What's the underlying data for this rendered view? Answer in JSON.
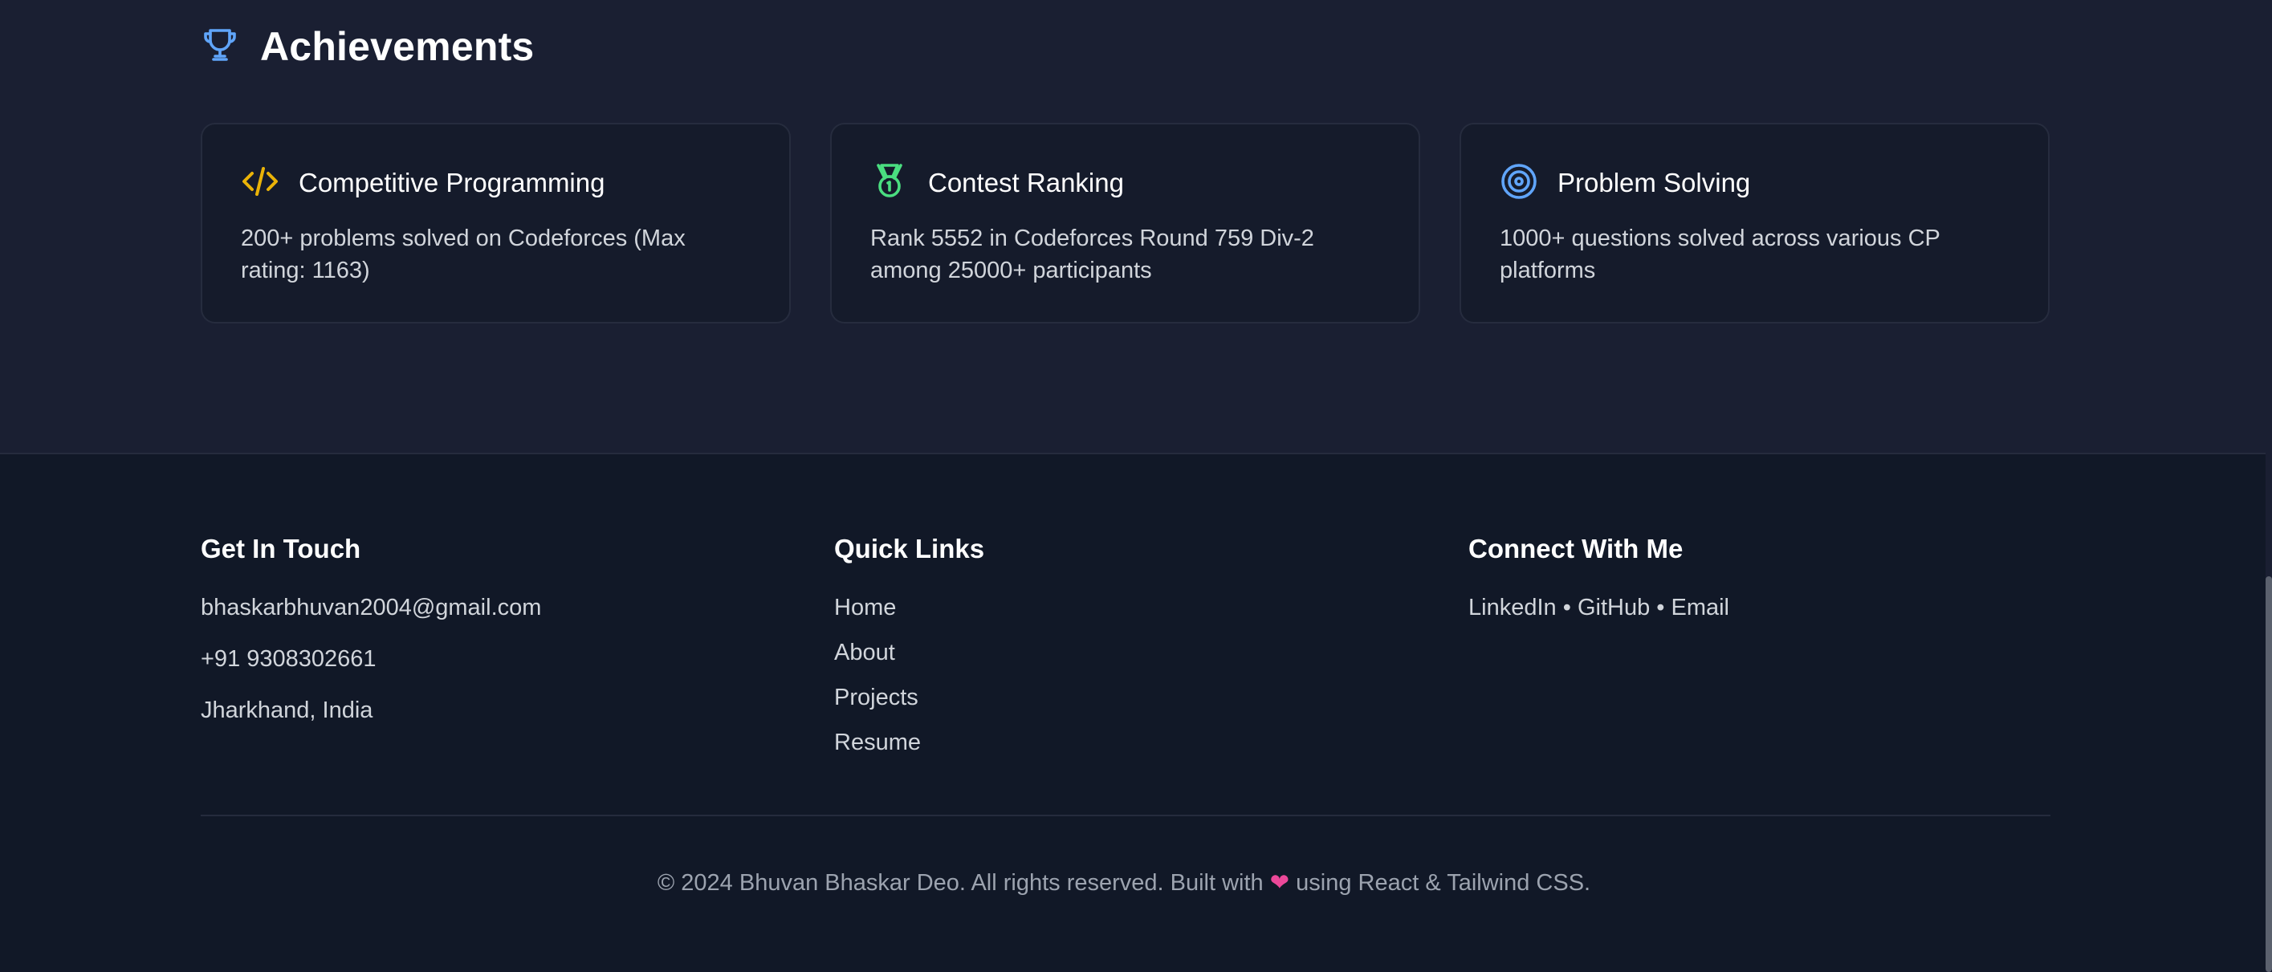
{
  "achievements": {
    "title": "Achievements",
    "cards": [
      {
        "icon": "code-icon",
        "title": "Competitive Programming",
        "description": "200+ problems solved on Codeforces (Max rating: 1163)",
        "color": "#eab308"
      },
      {
        "icon": "medal-icon",
        "title": "Contest Ranking",
        "description": "Rank 5552 in Codeforces Round 759 Div-2 among 25000+ participants",
        "color": "#4ade80"
      },
      {
        "icon": "target-icon",
        "title": "Problem Solving",
        "description": "1000+ questions solved across various CP platforms",
        "color": "#60a5fa"
      }
    ]
  },
  "footer": {
    "contact": {
      "heading": "Get In Touch",
      "email": "bhaskarbhuvan2004@gmail.com",
      "phone": "+91 9308302661",
      "location": "Jharkhand, India"
    },
    "quick_links": {
      "heading": "Quick Links",
      "items": [
        "Home",
        "About",
        "Projects",
        "Resume"
      ]
    },
    "connect": {
      "heading": "Connect With Me",
      "linkedin": "LinkedIn",
      "github": "GitHub",
      "email": "Email",
      "separator": " • "
    },
    "copyright_prefix": "© 2024 Bhuvan Bhaskar Deo. All rights reserved. Built with",
    "heart": "❤",
    "copyright_suffix": "using React & Tailwind CSS."
  },
  "colors": {
    "accent": "#60a5fa",
    "background": "#111827",
    "section_bg": "#1a1f32"
  }
}
